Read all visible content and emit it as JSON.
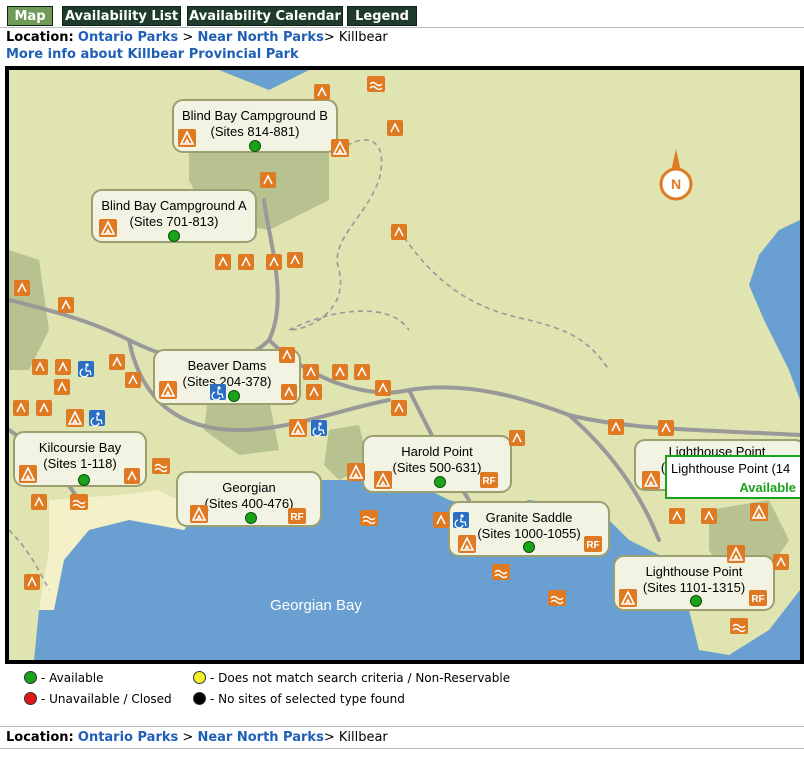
{
  "tabs": [
    {
      "label": "Map",
      "active": true
    },
    {
      "label": "Availability List",
      "active": false
    },
    {
      "label": "Availability Calendar",
      "active": false
    },
    {
      "label": "Legend",
      "active": false
    }
  ],
  "location": {
    "prefix": "Location:",
    "crumbs": [
      "Ontario Parks",
      "Near North Parks"
    ],
    "separator_1": " > ",
    "separator_2": "> ",
    "current": "Killbear"
  },
  "more_info": "More info about Killbear Provincial Park",
  "map": {
    "water_label": "Georgian Bay",
    "compass": "N",
    "campgrounds": [
      {
        "name": "Blind Bay Campground B",
        "sites": "(Sites 814-881)",
        "status": "available"
      },
      {
        "name": "Blind Bay Campground A",
        "sites": "(Sites 701-813)",
        "status": "available"
      },
      {
        "name": "Beaver Dams",
        "sites": "(Sites 204-378)",
        "status": "available"
      },
      {
        "name": "Kilcoursie Bay",
        "sites": "(Sites 1-118)",
        "status": "available"
      },
      {
        "name": "Georgian",
        "sites": "(Sites 400-476)",
        "status": "available"
      },
      {
        "name": "Harold Point",
        "sites": "(Sites 500-631)",
        "status": "available"
      },
      {
        "name": "Granite Saddle",
        "sites": "(Sites 1000-1055)",
        "status": "available"
      },
      {
        "name": "Lighthouse Point",
        "sites": "(Sites 1101-1315)",
        "status": "available"
      },
      {
        "name": "Lighthouse Point",
        "sites": "(",
        "status": "available"
      }
    ],
    "tooltip": {
      "title": "Lighthouse Point (14",
      "status": "Available"
    }
  },
  "legend": [
    {
      "label": "- Available",
      "color": "#1aa31a"
    },
    {
      "label": "- Does not match search criteria / Non-Reservable",
      "color": "#f5ee2a"
    },
    {
      "label": "- Unavailable / Closed",
      "color": "#e01818"
    },
    {
      "label": "- No sites of selected type found",
      "color": "#000000"
    }
  ],
  "colors": {
    "water": "#6a9fd1",
    "land": "#dfe4b0",
    "land_dark": "#b7c290",
    "road": "#999999",
    "icon": "#e07a22",
    "accent": "#1f5fb5"
  }
}
